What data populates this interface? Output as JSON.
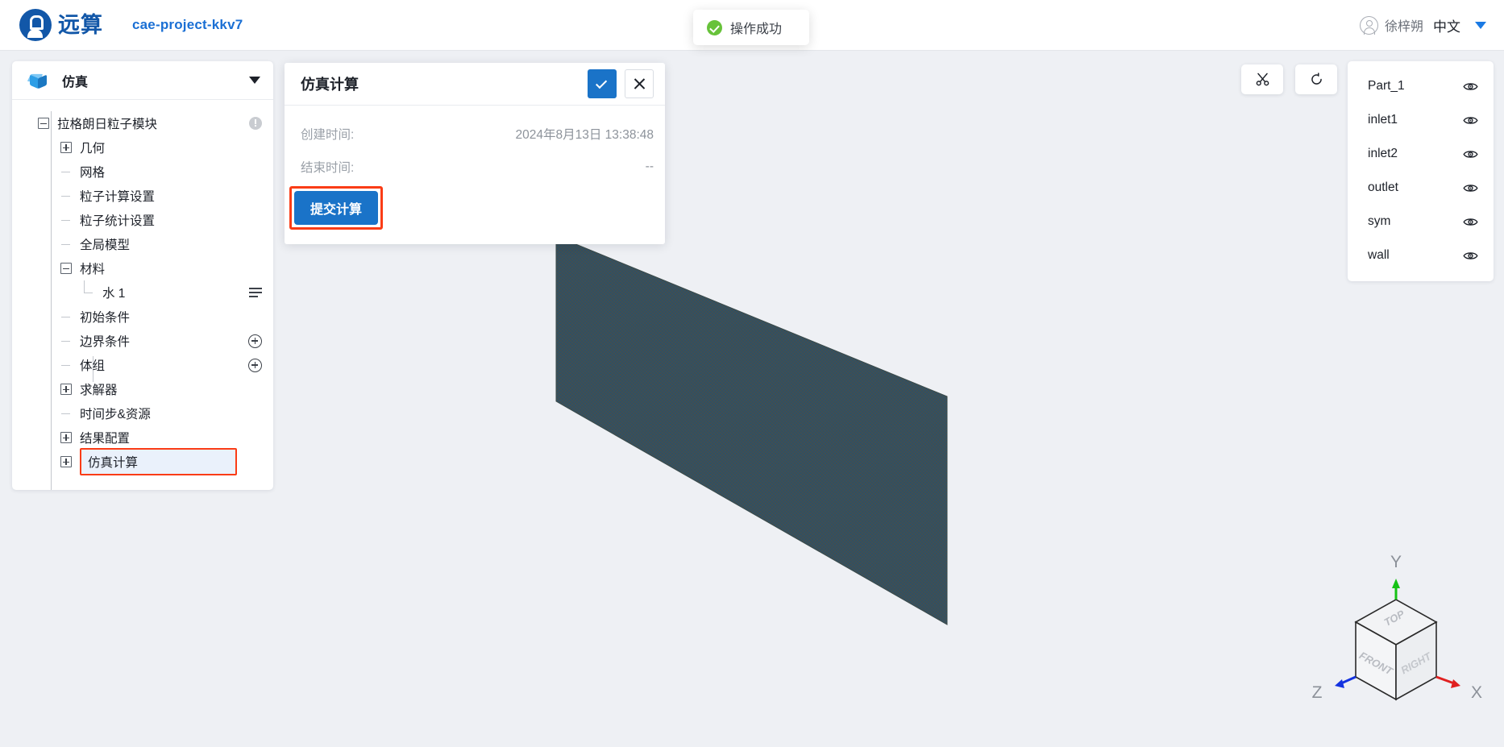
{
  "header": {
    "brand_name": "远算",
    "project_name": "cae-project-kkv7",
    "user_name": "徐梓朔",
    "language": "中文",
    "avatar_icon": "user-circle-icon",
    "caret_icon": "chevron-down-icon"
  },
  "toast": {
    "message": "操作成功",
    "icon": "success-check-icon",
    "color": "#67c23a"
  },
  "sidebar": {
    "title": "仿真",
    "icon": "cube-icon",
    "caret_icon": "chevron-down-icon",
    "tree": [
      {
        "label": "拉格朗日粒子模块",
        "depth": 0,
        "toggle": "minus",
        "action": "info-icon"
      },
      {
        "label": "几何",
        "depth": 1,
        "toggle": "plus",
        "action": ""
      },
      {
        "label": "网格",
        "depth": 1,
        "toggle": "branch",
        "action": ""
      },
      {
        "label": "粒子计算设置",
        "depth": 1,
        "toggle": "branch",
        "action": ""
      },
      {
        "label": "粒子统计设置",
        "depth": 1,
        "toggle": "branch",
        "action": ""
      },
      {
        "label": "全局模型",
        "depth": 1,
        "toggle": "branch",
        "action": ""
      },
      {
        "label": "材料",
        "depth": 1,
        "toggle": "minus",
        "action": ""
      },
      {
        "label": "水 1",
        "depth": 2,
        "toggle": "elbow",
        "action": "list-icon"
      },
      {
        "label": "初始条件",
        "depth": 1,
        "toggle": "branch",
        "action": ""
      },
      {
        "label": "边界条件",
        "depth": 1,
        "toggle": "branch",
        "action": "plus-circle-icon"
      },
      {
        "label": "体组",
        "depth": 1,
        "toggle": "branch",
        "action": "plus-circle-icon"
      },
      {
        "label": "求解器",
        "depth": 1,
        "toggle": "plus",
        "action": ""
      },
      {
        "label": "时间步&资源",
        "depth": 1,
        "toggle": "branch",
        "action": ""
      },
      {
        "label": "结果配置",
        "depth": 1,
        "toggle": "plus",
        "action": ""
      },
      {
        "label": "仿真计算",
        "depth": 1,
        "toggle": "plus",
        "action": "",
        "selected": true
      }
    ]
  },
  "dialog": {
    "title": "仿真计算",
    "confirm_icon": "check-icon",
    "cancel_icon": "close-icon",
    "fields": [
      {
        "label": "创建时间:",
        "value": "2024年8月13日 13:38:48"
      },
      {
        "label": "结束时间:",
        "value": "--"
      }
    ],
    "submit_label": "提交计算",
    "highlight_color": "#fa3c16",
    "accent_color": "#1a73c8"
  },
  "view_toolbar": {
    "buttons": [
      {
        "icon": "scissors-icon",
        "name": "clip-tool"
      },
      {
        "icon": "reset-view-icon",
        "name": "reset-view-tool"
      }
    ]
  },
  "parts_panel": {
    "items": [
      {
        "name": "Part_1",
        "visibility_icon": "eye-icon"
      },
      {
        "name": "inlet1",
        "visibility_icon": "eye-icon"
      },
      {
        "name": "inlet2",
        "visibility_icon": "eye-icon"
      },
      {
        "name": "outlet",
        "visibility_icon": "eye-icon"
      },
      {
        "name": "sym",
        "visibility_icon": "eye-icon"
      },
      {
        "name": "wall",
        "visibility_icon": "eye-icon"
      }
    ]
  },
  "gizmo": {
    "axis_x": "X",
    "axis_y": "Y",
    "axis_z": "Z",
    "face_front": "FRONT",
    "face_right": "RIGHT",
    "face_top": "TOP",
    "x_color": "#e02020",
    "y_color": "#15c215",
    "z_color": "#1433e0"
  },
  "viewport": {
    "background": "#eef0f4",
    "mesh_color": "#2b5066",
    "mesh_edge_color": "#4a4b46"
  }
}
